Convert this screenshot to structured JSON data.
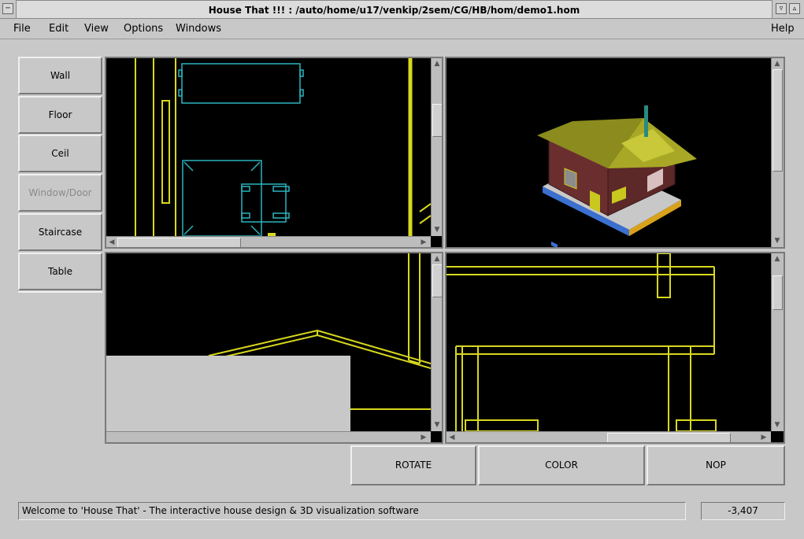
{
  "window": {
    "title": "House That !!! : /auto/home/u17/venkip/2sem/CG/HB/hom/demo1.hom"
  },
  "menubar": {
    "items": [
      "File",
      "Edit",
      "View",
      "Options",
      "Windows"
    ],
    "help": "Help"
  },
  "tools": [
    {
      "label": "Wall",
      "enabled": true
    },
    {
      "label": "Floor",
      "enabled": true
    },
    {
      "label": "Ceil",
      "enabled": true
    },
    {
      "label": "Window/Door",
      "enabled": false
    },
    {
      "label": "Staircase",
      "enabled": true
    },
    {
      "label": "Table",
      "enabled": true
    }
  ],
  "actions": {
    "rotate": "ROTATE",
    "color": "COLOR",
    "nop": "NOP"
  },
  "status": {
    "message": "Welcome to 'House That' - The interactive house design & 3D visualization software",
    "coordinate": "-3,407"
  },
  "colors": {
    "wireframe": "#d8d81e",
    "furniture": "#2ab4c0",
    "background": "#c8c8c8"
  }
}
